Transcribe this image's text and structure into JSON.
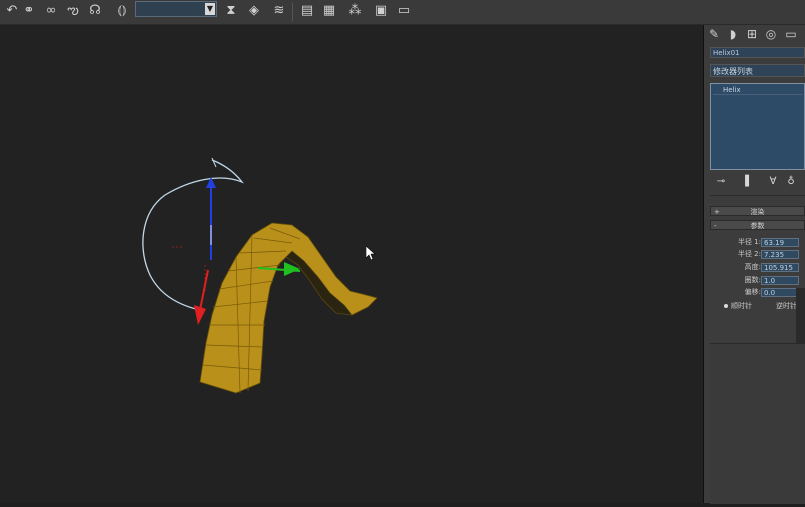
{
  "toolbar": {
    "icons": [
      "curve-arrow-icon",
      "unlink-icon",
      "link-icon",
      "bind-icon",
      "bracket-icon",
      "selection-filter-combo",
      "mirror-icon",
      "align-icon",
      "layers-icon",
      "curve-editor-icon",
      "schematic-icon",
      "material-editor-icon",
      "render-setup-icon",
      "render-frame-icon"
    ]
  },
  "command_panel": {
    "tabs": [
      "create-tab-icon",
      "modify-tab-icon",
      "hierarchy-tab-icon",
      "motion-tab-icon",
      "display-tab-icon"
    ],
    "object_name": "Helix01",
    "modifier_list_label": "修改器列表",
    "stack": {
      "items": [
        {
          "label": "Helix"
        }
      ]
    },
    "rollouts": {
      "rendering": {
        "sign": "+",
        "title": "渲染"
      },
      "parameters": {
        "sign": "-",
        "title": "参数"
      }
    },
    "parameters": [
      {
        "label": "半径 1:",
        "value": "63.19"
      },
      {
        "label": "半径 2:",
        "value": "7.235"
      },
      {
        "label": "高度:",
        "value": "105.915"
      },
      {
        "label": "圈数:",
        "value": "1.0"
      },
      {
        "label": "偏移:",
        "value": "0.0"
      }
    ],
    "direction": {
      "cw_label": "顺时针",
      "ccw_label": "逆时针",
      "selected": "cw"
    }
  },
  "colors": {
    "viewport_bg": "#222222",
    "horn_fill": "#b8901a",
    "helix_line": "#c0d8e8",
    "gizmo_x": "#e02020",
    "gizmo_y": "#20c020",
    "gizmo_z": "#2040e0"
  }
}
